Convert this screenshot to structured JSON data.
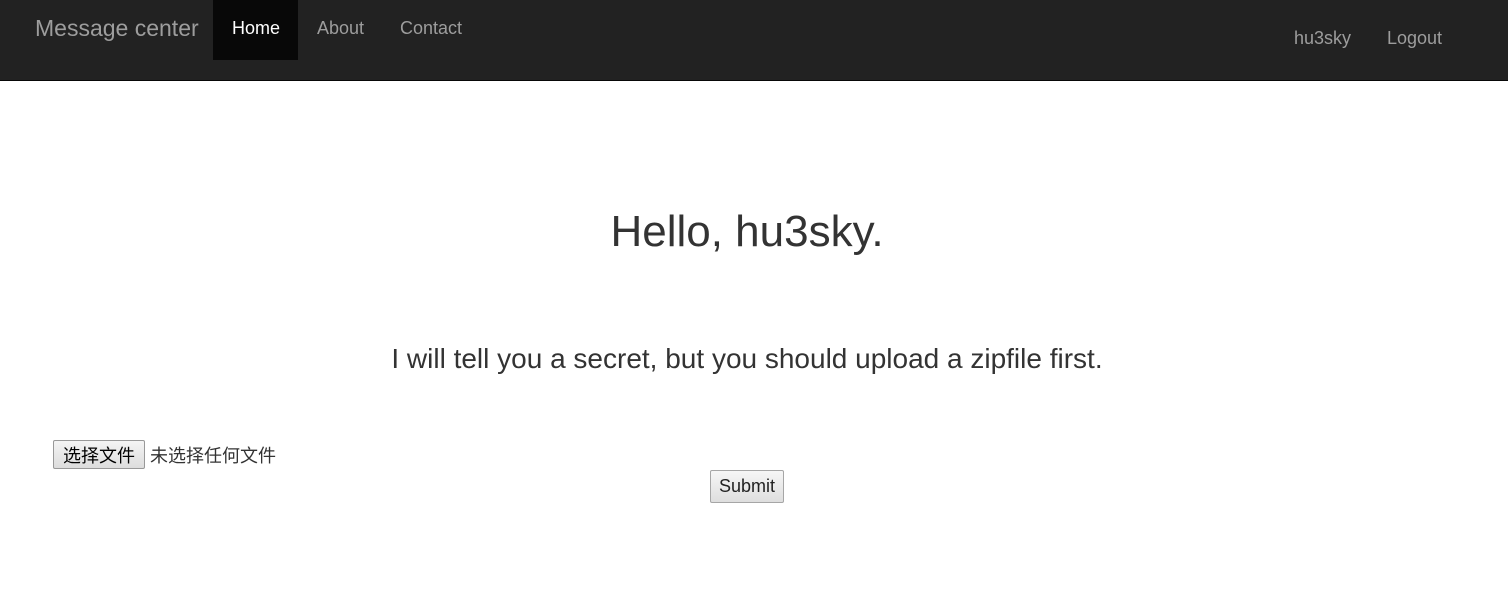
{
  "navbar": {
    "brand": "Message center",
    "links": [
      {
        "label": "Home",
        "active": true
      },
      {
        "label": "About",
        "active": false
      },
      {
        "label": "Contact",
        "active": false
      }
    ],
    "user": "hu3sky",
    "logout": "Logout"
  },
  "main": {
    "greeting": "Hello, hu3sky.",
    "message": "I will tell you a secret, but you should upload a zipfile first.",
    "file_input": {
      "button_label": "选择文件",
      "status": "未选择任何文件"
    },
    "submit_label": "Submit"
  },
  "colors": {
    "navbar_bg": "#222222",
    "active_tab_bg": "#080808",
    "nav_text": "#9d9d9d"
  }
}
